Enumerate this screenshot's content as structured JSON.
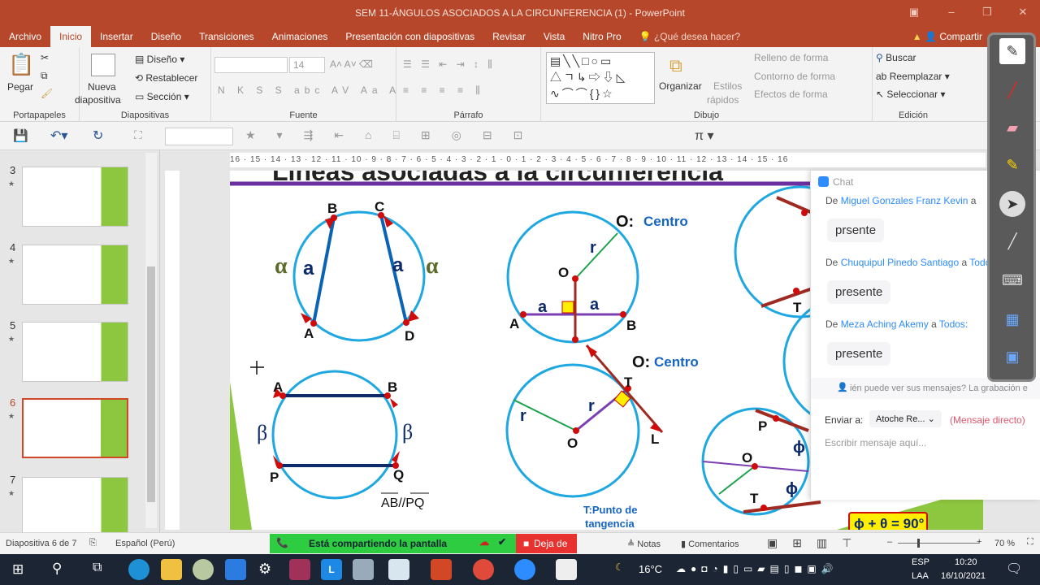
{
  "window": {
    "title": "SEM 11-ÁNGULOS ASOCIADOS A LA CIRCUNFERENCIA (1) - PowerPoint"
  },
  "tabs": [
    "Archivo",
    "Inicio",
    "Insertar",
    "Diseño",
    "Transiciones",
    "Animaciones",
    "Presentación con diapositivas",
    "Revisar",
    "Vista",
    "Nitro Pro"
  ],
  "active_tab": "Inicio",
  "tell_me": "¿Qué desea hacer?",
  "share_label": "Compartir",
  "ribbon": {
    "portapapeles": {
      "label": "Portapapeles",
      "pegar": "Pegar"
    },
    "diapositivas": {
      "label": "Diapositivas",
      "nueva1": "Nueva",
      "nueva2": "diapositiva",
      "diseno": "Diseño",
      "restablecer": "Restablecer",
      "seccion": "Sección"
    },
    "fuente": {
      "label": "Fuente",
      "size": "14",
      "font": ""
    },
    "parrafo": {
      "label": "Párrafo"
    },
    "dibujo": {
      "label": "Dibujo",
      "organizar": "Organizar",
      "estilos1": "Estilos",
      "estilos2": "rápidos",
      "relleno": "Relleno de forma",
      "contorno": "Contorno de forma",
      "efectos": "Efectos de forma"
    },
    "edicion": {
      "label": "Edición",
      "buscar": "Buscar",
      "reemplazar": "Reemplazar",
      "seleccionar": "Seleccionar"
    }
  },
  "ruler": "16 · 15 · 14 · 13 · 12 · 11 · 10 · 9 · 8 · 7 · 6 · 5 · 4 · 3 · 2 · 1 · 0 · 1 · 2 · 3 · 4 · 5 · 6 · 7 · 8 · 9 · 10 · 11 · 12 · 13 · 14 · 15 · 16",
  "thumbnails": [
    {
      "num": "3"
    },
    {
      "num": "4"
    },
    {
      "num": "5"
    },
    {
      "num": "6",
      "selected": true
    },
    {
      "num": "7"
    }
  ],
  "slide": {
    "title": "Líneas asociadas a la circunferencia",
    "labels": {
      "B": "B",
      "C": "C",
      "A": "A",
      "D": "D",
      "alpha": "α",
      "a": "a",
      "O": "O",
      "r": "r",
      "P": "P",
      "Q": "Q",
      "T": "T",
      "L": "L",
      "beta": "β",
      "phi": "ϕ"
    },
    "centro1": "Centro",
    "centro2": "Centro",
    "o_colon": "O:",
    "parallel": "AB//PQ",
    "tangencia1": "T:Punto de",
    "tangencia2": "tangencia",
    "formula": "ϕ + θ = 90°",
    "colors": {
      "circle": "#1ea7e1",
      "chord": "#0b63b6",
      "point": "#d10a0a",
      "tangent": "#9e2a22",
      "radius": "#1aa34a",
      "purple": "#7a3fb0"
    }
  },
  "chat": {
    "title": "Chat",
    "messages": [
      {
        "prefix": "De",
        "from": "Miguel Gonzales Franz Kevin",
        "to_prefix": "a",
        "to": "",
        "text": "prsente"
      },
      {
        "prefix": "De",
        "from": "Chuquipul Pinedo Santiago",
        "to_prefix": "a",
        "to": "Todos",
        "text": "presente"
      },
      {
        "prefix": "De",
        "from": "Meza Aching  Akemy",
        "to_prefix": "a",
        "to": "Todos:",
        "text": "presente"
      }
    ],
    "notice": "ién puede ver sus mensajes? La grabación e",
    "send_to_label": "Enviar a:",
    "recipient": "Atoche Re...",
    "direct": "(Mensaje directo)",
    "placeholder": "Escribir mensaje aquí..."
  },
  "status": {
    "slide": "Diapositiva 6 de 7",
    "language": "Español (Perú)",
    "notes": "Notas",
    "comments": "Comentarios",
    "zoom": "70 %",
    "sharing": "Está compartiendo la pantalla",
    "stop": "Deja de"
  },
  "taskbar": {
    "temp": "16°C",
    "lang1": "ESP",
    "lang2": "LAA",
    "time": "10:20",
    "date": "16/10/2021"
  }
}
